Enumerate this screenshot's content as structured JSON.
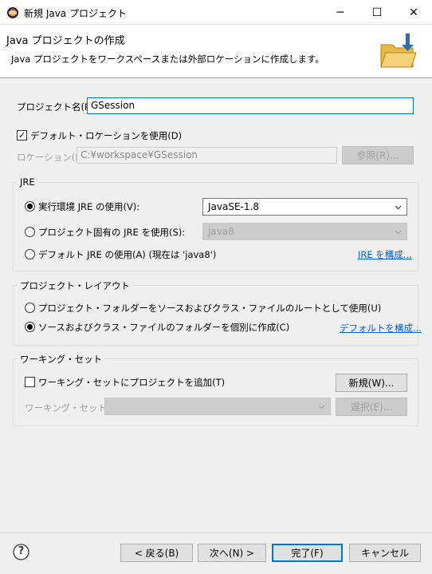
{
  "window": {
    "title": "新規 Java プロジェクト",
    "minimize_glyph": "─",
    "maximize_glyph": "☐",
    "close_glyph": "✕"
  },
  "banner": {
    "title": "Java プロジェクトの作成",
    "message": "Java プロジェクトをワークスペースまたは外部ロケーションに作成します。"
  },
  "project_name": {
    "label": "プロジェクト名(P):",
    "value": "GSession"
  },
  "default_location": {
    "checkbox_label": "デフォルト・ロケーションを使用(D)",
    "checked": true,
    "location_label": "ロケーション(L):",
    "location_value": "C:¥workspace¥GSession",
    "browse_button": "参照(R)..."
  },
  "jre": {
    "group_label": "JRE",
    "option1_label": "実行環境 JRE の使用(V):",
    "option1_value": "JavaSE-1.8",
    "option2_label": "プロジェクト固有の JRE を使用(S):",
    "option2_value": "java8",
    "option3_label": "デフォルト JRE の使用(A) (現在は 'java8')",
    "configure_link": "JRE を構成...",
    "selected": 1
  },
  "layout": {
    "group_label": "プロジェクト・レイアウト",
    "option1_label": "プロジェクト・フォルダーをソースおよびクラス・ファイルのルートとして使用(U)",
    "option2_label": "ソースおよびクラス・ファイルのフォルダーを個別に作成(C)",
    "configure_link": "デフォルトを構成...",
    "selected": 2
  },
  "working_sets": {
    "group_label": "ワーキング・セット",
    "checkbox_label": "ワーキング・セットにプロジェクトを追加(T)",
    "checked": false,
    "new_button": "新規(W)...",
    "sets_label": "ワーキング・セット(O):",
    "select_button": "選択(E)..."
  },
  "footer": {
    "help_glyph": "?",
    "back_button": "< 戻る(B)",
    "next_button": "次へ(N) >",
    "finish_button": "完了(F)",
    "cancel_button": "キャンセル"
  },
  "colors": {
    "focus": "#0078d7",
    "link": "#0066cc"
  }
}
